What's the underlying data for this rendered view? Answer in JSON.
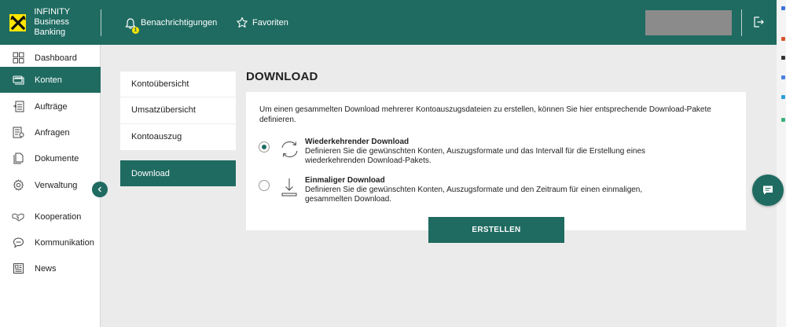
{
  "brand": {
    "line1": "INFINITY",
    "line2": "Business Banking"
  },
  "header": {
    "notifications": "Benachrichtigungen",
    "notification_count": "1",
    "favorites": "Favoriten"
  },
  "sidebar": {
    "items": [
      {
        "label": "Dashboard",
        "icon": "dashboard-icon"
      },
      {
        "label": "Konten",
        "icon": "accounts-icon"
      },
      {
        "label": "Aufträge",
        "icon": "orders-icon"
      },
      {
        "label": "Anfragen",
        "icon": "requests-icon"
      },
      {
        "label": "Dokumente",
        "icon": "documents-icon"
      },
      {
        "label": "Verwaltung",
        "icon": "gear-icon"
      },
      {
        "label": "Kooperation",
        "icon": "handshake-icon"
      },
      {
        "label": "Kommunikation",
        "icon": "chat-icon"
      },
      {
        "label": "News",
        "icon": "news-icon"
      }
    ]
  },
  "subnav": {
    "items": [
      "Kontoübersicht",
      "Umsatzübersicht",
      "Kontoauszug"
    ],
    "active": "Download"
  },
  "content": {
    "title": "DOWNLOAD",
    "intro": "Um einen gesammelten Download mehrerer Kontoauszugsdateien zu erstellen, können Sie hier entsprechende Download-Pakete definieren.",
    "options": [
      {
        "title": "Wiederkehrender Download",
        "desc": "Definieren Sie die gewünschten Konten, Auszugsformate und das Intervall für die Erstellung eines wiederkehrenden Download-Pakets.",
        "selected": true,
        "icon": "recurring-sync-icon"
      },
      {
        "title": "Einmaliger Download",
        "desc": "Definieren Sie die gewünschten Konten, Auszugsformate und den Zeitraum für einen einmaligen, gesammelten Download.",
        "selected": false,
        "icon": "download-icon"
      }
    ],
    "button": "ERSTELLEN"
  },
  "colors": {
    "primary": "#1f6b61",
    "accent": "#ffe600",
    "background": "#ebebeb"
  }
}
